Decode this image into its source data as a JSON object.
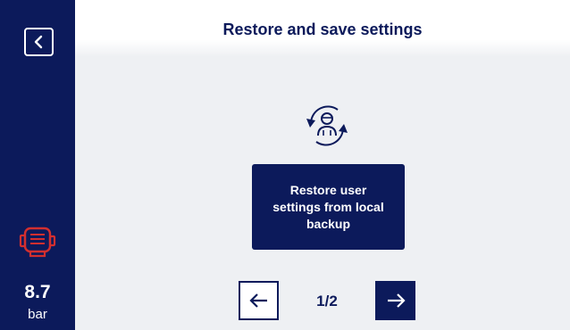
{
  "app": {
    "title": "Restore and save settings"
  },
  "sidebar": {
    "back_icon": "chevron-left-icon",
    "motor_icon": "motor-icon",
    "motor_icon_color": "#d32f2f",
    "pressure": {
      "value": "8.7",
      "unit": "bar"
    }
  },
  "main": {
    "restore_icon": "restore-user-icon",
    "restore_button_label": "Restore user settings from local backup"
  },
  "pagination": {
    "prev_icon": "arrow-left-icon",
    "next_icon": "arrow-right-icon",
    "indicator": "1/2"
  },
  "colors": {
    "primary": "#0c1a5b",
    "background": "#eef0f3",
    "alert": "#d32f2f"
  }
}
